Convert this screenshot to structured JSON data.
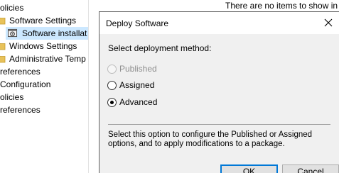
{
  "tree": {
    "items": [
      {
        "label": "olicies"
      },
      {
        "label": "Software Settings"
      },
      {
        "label": "Software installat"
      },
      {
        "label": "Windows Settings"
      },
      {
        "label": "Administrative Temp"
      },
      {
        "label": "references"
      },
      {
        "label": "Configuration"
      },
      {
        "label": "olicies"
      },
      {
        "label": "references"
      }
    ]
  },
  "right_pane": {
    "empty_message": "There are no items to show in t"
  },
  "dialog": {
    "title": "Deploy Software",
    "prompt": "Select deployment method:",
    "options": [
      {
        "label": "Published",
        "enabled": false,
        "checked": false
      },
      {
        "label": "Assigned",
        "enabled": true,
        "checked": false
      },
      {
        "label": "Advanced",
        "enabled": true,
        "checked": true
      }
    ],
    "description": "Select this option to configure the Published or Assigned options, and to apply modifications to a package.",
    "ok_label": "OK",
    "cancel_label": "Cancel"
  },
  "colors": {
    "selection": "#cce8ff",
    "default_button_border": "#0078d7",
    "dialog_body": "#f0f0f0"
  },
  "icons": {
    "folder": "folder-icon",
    "software_installation": "software-installation-icon",
    "close": "close-icon"
  }
}
